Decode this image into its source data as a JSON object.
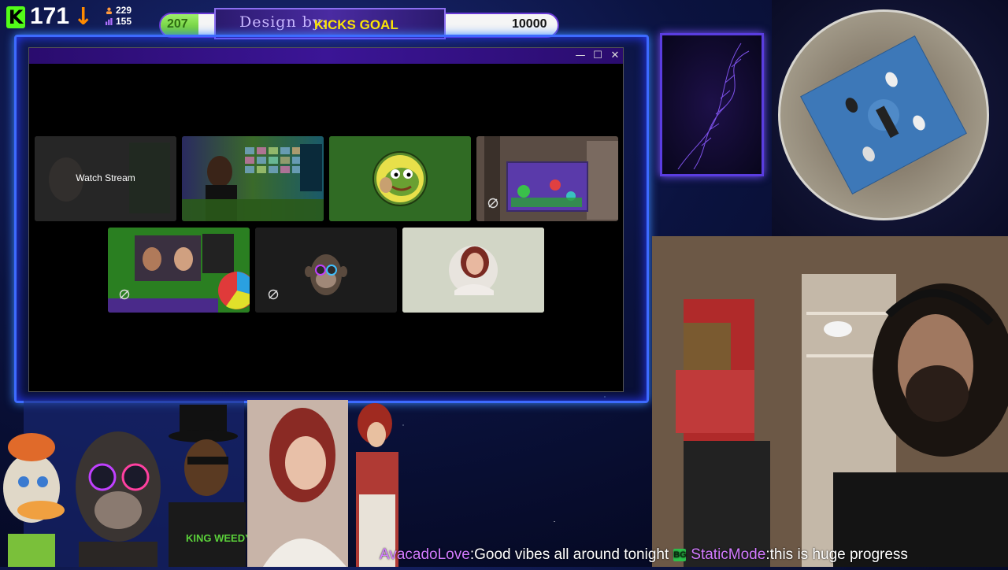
{
  "stats": {
    "kick_count": "171",
    "followers_up": "229",
    "followers_down": "155"
  },
  "goal": {
    "current": "207",
    "design_by": "Design by:",
    "label": "KICKS GOAL",
    "target": "10000",
    "progress_fraction": 0.0207
  },
  "window": {
    "minimize": "—",
    "maximize": "☐",
    "close": "✕"
  },
  "tiles": {
    "watch_stream": "Watch Stream",
    "shirt_text": "KING WEEDY"
  },
  "chat": [
    {
      "name": "AvacadoLove",
      "message": "Good vibes all around tonight",
      "badge": "BG"
    },
    {
      "name": "StaticMode",
      "message": "this is huge progress"
    }
  ],
  "colors": {
    "kick_green": "#53fc18",
    "goal_fill": "#7ad94a",
    "neon_blue": "#3d6bff",
    "chat_name": "#d27bff",
    "goal_label": "#ffe600"
  }
}
